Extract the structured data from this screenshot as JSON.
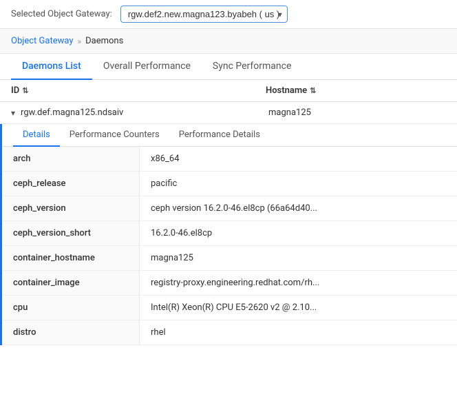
{
  "topbar": {
    "label": "Selected Object Gateway:",
    "gateway_value": "rgw.def2.new.magna123.byabeh ( us )",
    "gateway_placeholder": "rgw.def2.new.magna123.byabeh ( us )"
  },
  "breadcrumb": {
    "root": "Object Gateway",
    "separator": "»",
    "current": "Daemons"
  },
  "tabs": [
    {
      "label": "Daemons List",
      "active": true
    },
    {
      "label": "Overall Performance",
      "active": false
    },
    {
      "label": "Sync Performance",
      "active": false
    }
  ],
  "table": {
    "col_id": "ID",
    "col_hostname": "Hostname",
    "rows": [
      {
        "id": "rgw.def.magna125.ndsaiv",
        "hostname": "magna125",
        "expanded": true
      }
    ]
  },
  "inner_tabs": [
    {
      "label": "Details",
      "active": true
    },
    {
      "label": "Performance Counters",
      "active": false
    },
    {
      "label": "Performance Details",
      "active": false
    }
  ],
  "details": [
    {
      "key": "arch",
      "value": "x86_64"
    },
    {
      "key": "ceph_release",
      "value": "pacific"
    },
    {
      "key": "ceph_version",
      "value": "ceph version 16.2.0-46.el8cp (66a64d40..."
    },
    {
      "key": "ceph_version_short",
      "value": "16.2.0-46.el8cp"
    },
    {
      "key": "container_hostname",
      "value": "magna125"
    },
    {
      "key": "container_image",
      "value": "registry-proxy.engineering.redhat.com/rh..."
    },
    {
      "key": "cpu",
      "value": "Intel(R) Xeon(R) CPU E5-2620 v2 @ 2.10..."
    },
    {
      "key": "distro",
      "value": "rhel"
    }
  ]
}
